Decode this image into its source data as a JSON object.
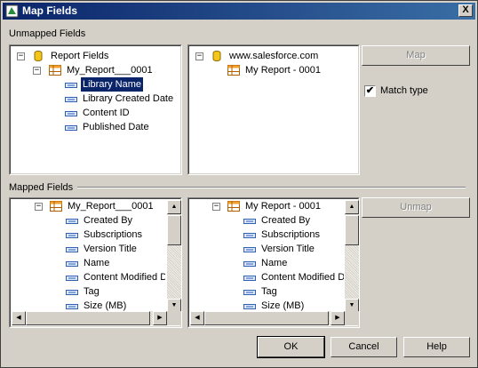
{
  "window": {
    "title": "Map Fields",
    "close_label": "X"
  },
  "sections": {
    "unmapped": "Unmapped Fields",
    "mapped": "Mapped Fields"
  },
  "unmapped_left": {
    "root": "Report Fields",
    "report": "My_Report___0001",
    "fields": [
      "Library Name",
      "Library Created Date",
      "Content ID",
      "Published Date"
    ],
    "selected_index": 0
  },
  "unmapped_right": {
    "root": "www.salesforce.com",
    "report": "My Report - 0001"
  },
  "mapped_left": {
    "report": "My_Report___0001",
    "fields": [
      "Created By",
      "Subscriptions",
      "Version Title",
      "Name",
      "Content Modified Da",
      "Tag",
      "Size (MB)"
    ]
  },
  "mapped_right": {
    "report": "My Report - 0001",
    "fields": [
      "Created By",
      "Subscriptions",
      "Version Title",
      "Name",
      "Content Modified Da",
      "Tag",
      "Size (MB)"
    ]
  },
  "buttons": {
    "map": "Map",
    "unmap": "Unmap",
    "ok": "OK",
    "cancel": "Cancel",
    "help": "Help"
  },
  "match_type": {
    "label": "Match type",
    "checked": true,
    "check_glyph": "✔"
  },
  "glyphs": {
    "collapse": "−",
    "up": "▲",
    "down": "▼",
    "left": "◀",
    "right": "▶"
  },
  "icons": {
    "database": "database-icon",
    "report": "table-icon",
    "field": "field-icon"
  }
}
